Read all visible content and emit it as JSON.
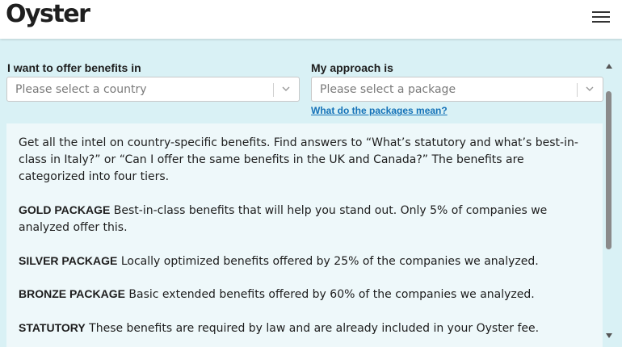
{
  "header": {
    "logo_text": "Oyster",
    "menu_icon": "hamburger-menu-icon"
  },
  "form": {
    "country": {
      "label": "I want to offer benefits in",
      "placeholder": "Please select a country"
    },
    "package": {
      "label": "My approach is",
      "placeholder": "Please select a package"
    },
    "help_link": "What do the packages mean?"
  },
  "info": {
    "intro": "Get all the intel on country-specific benefits. Find answers to “What’s statutory and what’s best-in-class in Italy?” or “Can I offer the same benefits in the UK and Canada?” The benefits are categorized into four tiers.",
    "tiers": [
      {
        "name": "GOLD PACKAGE",
        "text": " Best-in-class benefits that will help you stand out. Only 5% of companies we analyzed offer this."
      },
      {
        "name": "SILVER PACKAGE",
        "text": " Locally optimized benefits offered by 25% of the companies we analyzed."
      },
      {
        "name": "BRONZE PACKAGE",
        "text": " Basic extended benefits offered by 60% of the companies we analyzed."
      },
      {
        "name": "STATUTORY",
        "text": " These benefits are required by law and are already included in your Oyster fee."
      }
    ]
  },
  "colors": {
    "background": "#d9f1f5",
    "card": "#eef8fa",
    "link": "#1472b8"
  }
}
